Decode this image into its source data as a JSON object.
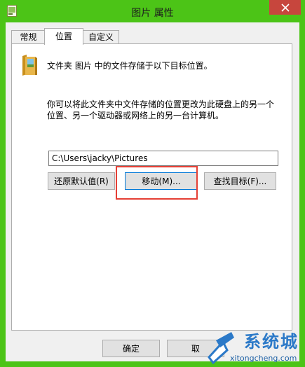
{
  "window": {
    "title": "图片 属性",
    "accent_color": "#4cc417",
    "close_color": "#c7463d"
  },
  "tabs": [
    {
      "label": "常规",
      "active": false
    },
    {
      "label": "位置",
      "active": true
    },
    {
      "label": "自定义",
      "active": false
    }
  ],
  "location": {
    "folder_icon": "folder-icon",
    "description_1": "文件夹 图片 中的文件存储于以下目标位置。",
    "description_2": "你可以将此文件夹中文件存储的位置更改为此硬盘上的另一个位置、另一个驱动器或网络上的另一台计算机。",
    "path_value": "C:\\Users\\jacky\\Pictures",
    "restore_label": "还原默认值(R)",
    "move_label": "移动(M)...",
    "find_label": "查找目标(F)..."
  },
  "footer": {
    "ok_label": "确定",
    "cancel_label": "取"
  },
  "watermark": {
    "brand": "系统城",
    "url": "xitongcheng.com"
  }
}
